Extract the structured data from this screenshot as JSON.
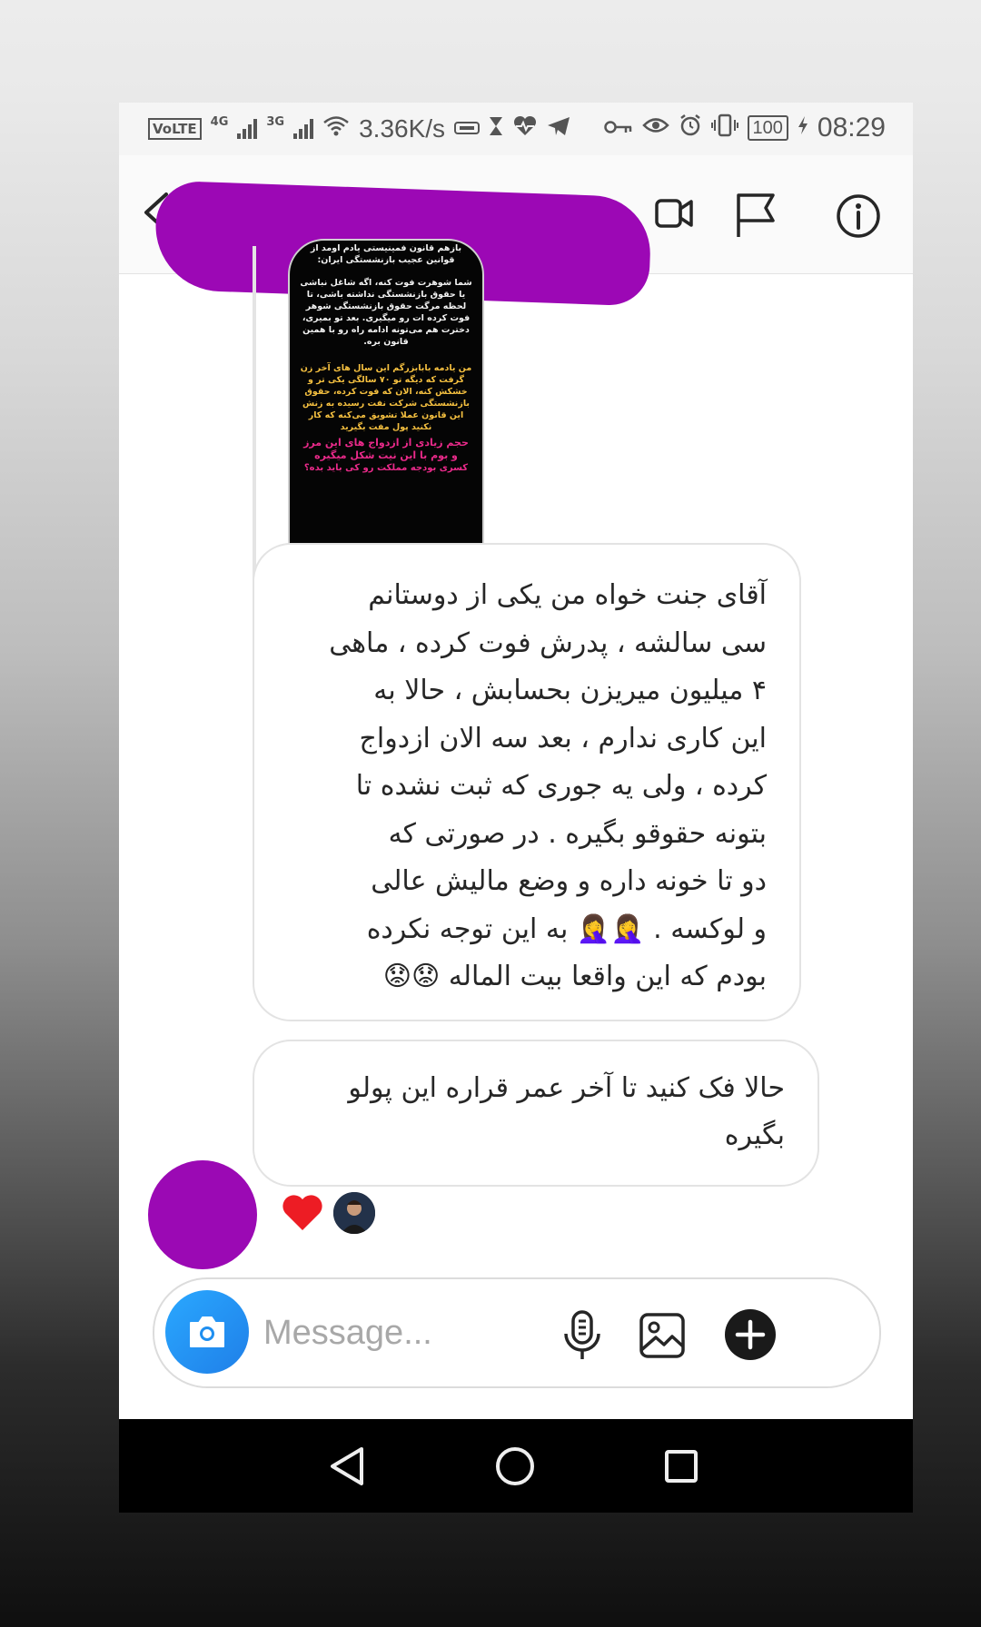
{
  "status_bar": {
    "carrier_badge": "VoLTE",
    "network_1": "4G",
    "network_2": "3G",
    "speed": "3.36K/s",
    "battery": "100",
    "time": "08:29"
  },
  "header": {
    "icons": [
      "back-arrow-icon",
      "video-call-icon",
      "flag-icon",
      "info-icon"
    ]
  },
  "shared_story": {
    "lines_white_1": "بازهم قانون فمینیستی یادم اومد از قوانین عجیب بازنشستگی ایران:",
    "lines_white_2": "شما شوهرت فوت کنه، اگه شاغل نباشی یا حقوق بازنشستگی نداشته باشی، تا لحظه مرگت حقوق بازنشستگی شوهر فوت کرده ات رو میگیری. بعد تو بمیری، دخترت هم می‌تونه ادامه راه رو با همین قانون بره.",
    "lines_yellow": "من یادمه بابابزرگم این سال های آخر زن گرفت که دیگه تو ۷۰ سالگی یکی تر و خشکش کنه، الان که فوت کرده، حقوق بازنشستگی شرکت نفت رسیده به زنش این قانون عملا تشویق می‌کنه که کار نکنید پول مفت بگیرید",
    "lines_pink_1": "حجم زیادی از ازدواج های این مرز و بوم با این نیت شکل میگیره",
    "lines_pink_2": "کسری بودجه مملکت رو کی باید بده؟"
  },
  "messages": [
    {
      "lines": [
        "آقای جنت خواه من یکی از دوستانم",
        "سی سالشه ، پدرش فوت کرده ، ماهی",
        "۴ میلیون میریزن بحسابش ، حالا به",
        "این کاری ندارم ، بعد سه الان ازدواج",
        "کرده ، ولی یه جوری که ثبت نشده تا",
        "بتونه حقوقو بگیره . در صورتی که",
        "دو تا خونه داره و وضع مالیش عالی",
        "و لوکسه .",
        "به این توجه نکرده",
        "بودم که  این واقعا بیت الماله"
      ],
      "emoji_facepalm": "🤦‍♀️🤦‍♀️",
      "emoji_sad": "😟😟"
    },
    {
      "lines": [
        "حالا فک کنید تا آخر عمر قراره این پولو",
        "بگیره"
      ]
    }
  ],
  "reactions": {
    "heart": "❤",
    "reactor_avatar": "user-avatar"
  },
  "composer": {
    "placeholder": "Message...",
    "icons": [
      "camera-icon",
      "microphone-icon",
      "gallery-icon",
      "plus-icon"
    ]
  },
  "colors": {
    "redaction": "#9c08b5",
    "camera_button": "#1f8ff0",
    "heart": "#ed1c24",
    "story_yellow": "#f5c040",
    "story_pink": "#ea2a8a"
  }
}
